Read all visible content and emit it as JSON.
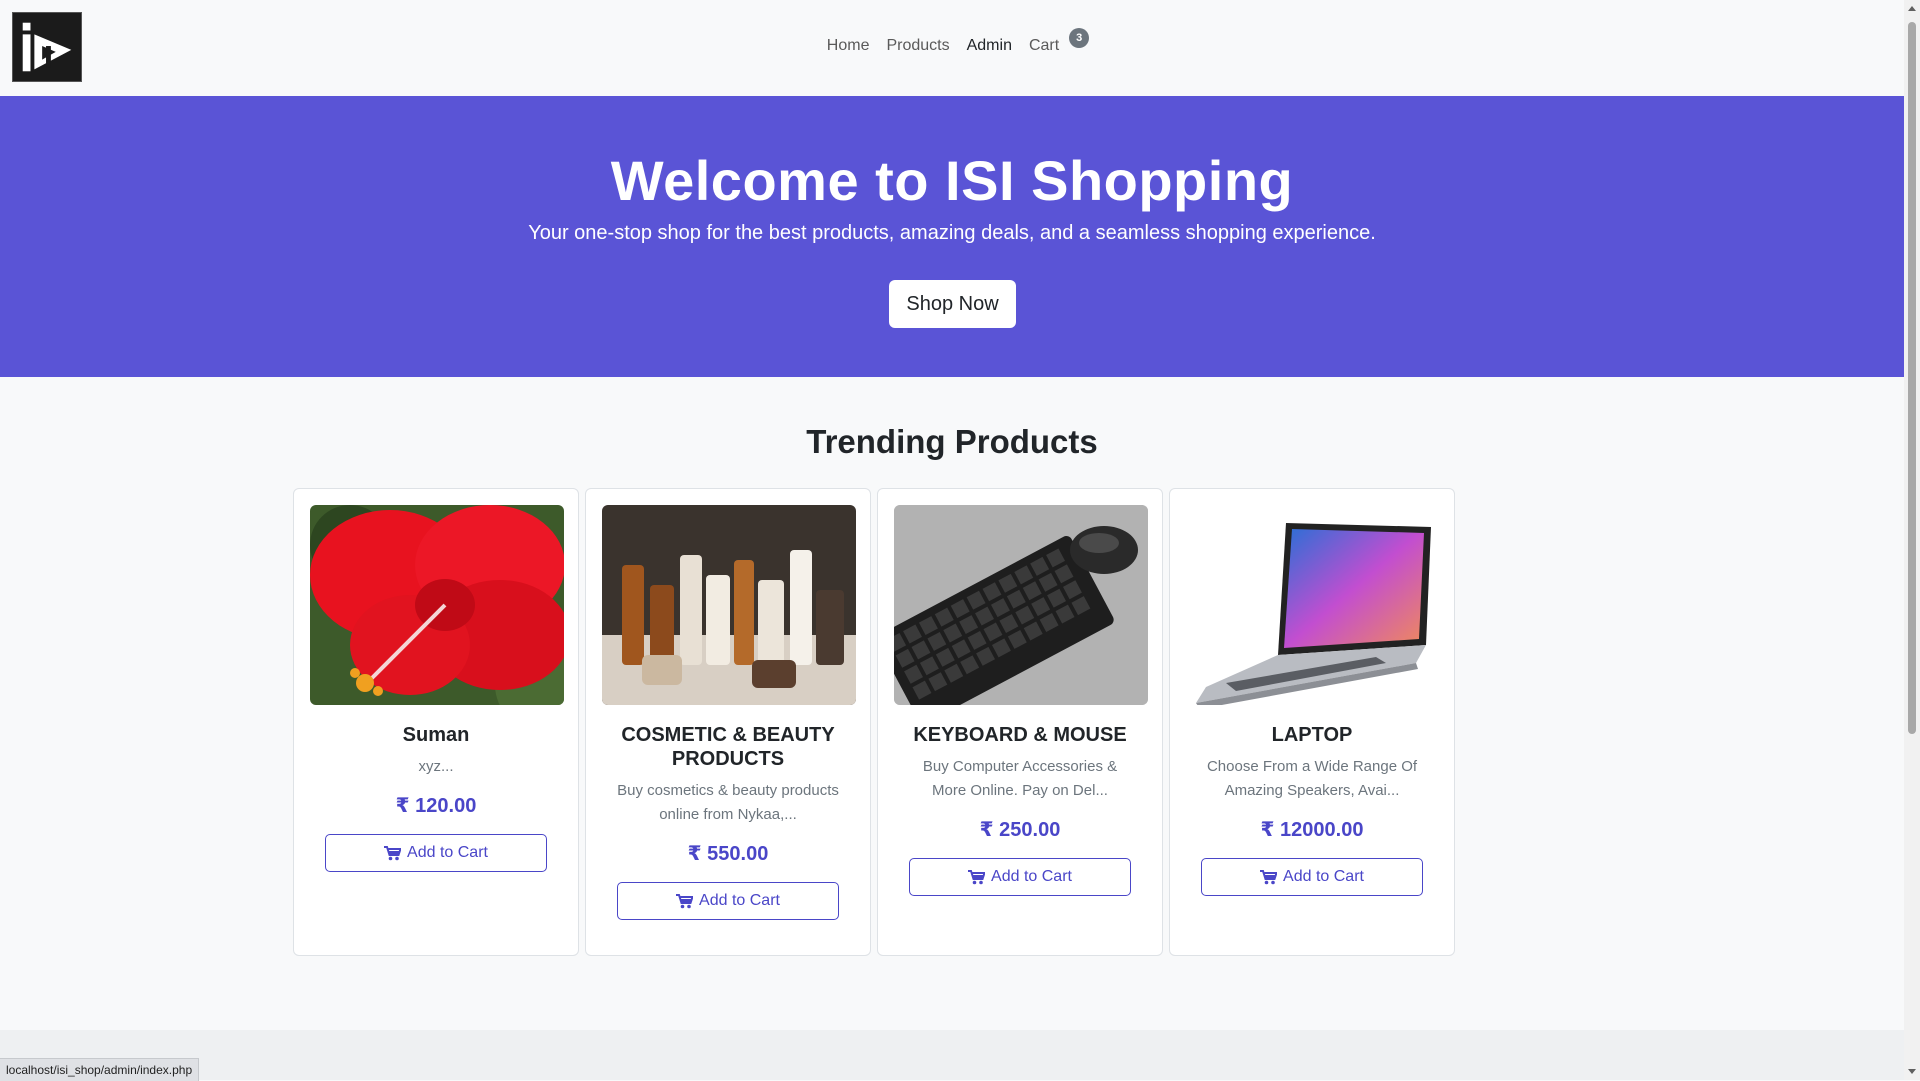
{
  "navbar": {
    "links": [
      {
        "label": "Home"
      },
      {
        "label": "Products"
      },
      {
        "label": "Admin"
      },
      {
        "label": "Cart"
      }
    ],
    "cart_count": "3",
    "active": "Admin"
  },
  "hero": {
    "title": "Welcome to ISI Shopping",
    "subtitle": "Your one-stop shop for the best products, amazing deals, and a seamless shopping experience.",
    "button": "Shop Now"
  },
  "trending": {
    "title": "Trending Products",
    "products": [
      {
        "name": "Suman",
        "desc": "xyz...",
        "price": "₹ 120.00",
        "button": "Add to Cart",
        "image": "red-hibiscus-flower"
      },
      {
        "name": "COSMETIC & BEAUTY PRODUCTS",
        "desc": "Buy cosmetics & beauty products online from Nykaa,...",
        "price": "₹ 550.00",
        "button": "Add to Cart",
        "image": "cosmetic-bottles"
      },
      {
        "name": "KEYBOARD & MOUSE",
        "desc": "Buy Computer Accessories & More Online. Pay on Del...",
        "price": "₹ 250.00",
        "button": "Add to Cart",
        "image": "keyboard-and-mouse"
      },
      {
        "name": "LAPTOP",
        "desc": "Choose From a Wide Range Of Amazing Speakers, Avai...",
        "price": "₹ 12000.00",
        "button": "Add to Cart",
        "image": "laptop"
      }
    ]
  },
  "status_bar": {
    "url": "localhost/isi_shop/admin/index.php"
  },
  "colors": {
    "hero_bg": "#5a54d6",
    "accent": "#4a46c8"
  }
}
